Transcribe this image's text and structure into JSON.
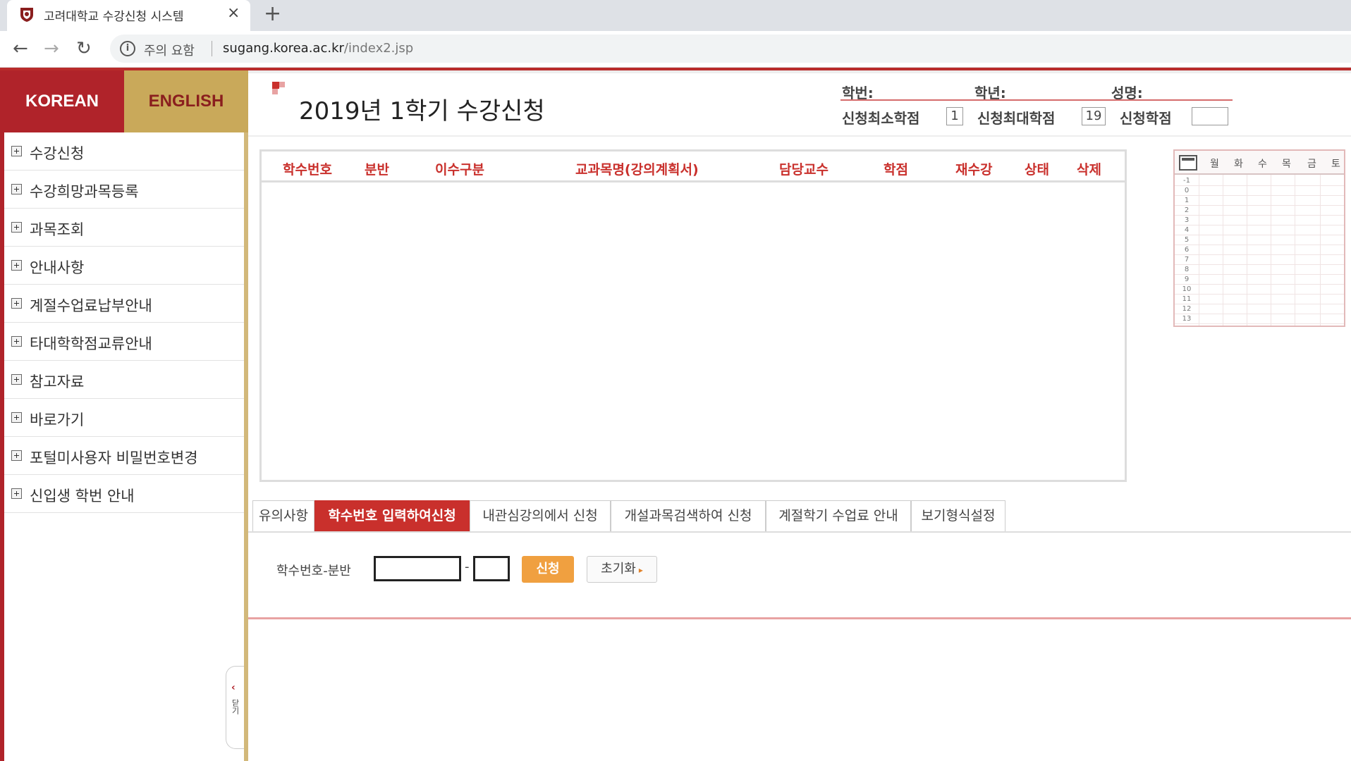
{
  "browser": {
    "tab_title": "고려대학교 수강신청 시스템",
    "tab_close": "×",
    "new_tab": "+",
    "back": "←",
    "forward": "→",
    "reload": "↻",
    "security_label": "주의 요함",
    "url_host": "sugang.korea.ac.kr",
    "url_path": "/index2.jsp"
  },
  "sidebar": {
    "lang_korean": "KOREAN",
    "lang_english": "ENGLISH",
    "items": [
      {
        "label": "수강신청"
      },
      {
        "label": "수강희망과목등록"
      },
      {
        "label": "과목조회"
      },
      {
        "label": "안내사항"
      },
      {
        "label": "계절수업료납부안내"
      },
      {
        "label": "타대학학점교류안내"
      },
      {
        "label": "참고자료"
      },
      {
        "label": "바로가기"
      },
      {
        "label": "포털미사용자 비밀번호변경"
      },
      {
        "label": "신입생 학번 안내"
      }
    ],
    "collapse_label": "닫기"
  },
  "header": {
    "title": "2019년 1학기 수강신청",
    "student_id_label": "학번:",
    "grade_label": "학년:",
    "name_label": "성명:",
    "min_credits_label": "신청최소학점",
    "min_credits_value": "1",
    "max_credits_label": "신청최대학점",
    "max_credits_value": "19",
    "applied_credits_label": "신청학점",
    "applied_credits_value": ""
  },
  "course_table": {
    "columns": [
      "학수번호",
      "분반",
      "이수구분",
      "교과목명(강의계획서)",
      "담당교수",
      "학점",
      "재수강",
      "상태",
      "삭제"
    ],
    "rows": []
  },
  "timetable": {
    "days": [
      "월",
      "화",
      "수",
      "목",
      "금",
      "토"
    ],
    "periods": [
      "-1",
      "0",
      "1",
      "2",
      "3",
      "4",
      "5",
      "6",
      "7",
      "8",
      "9",
      "10",
      "11",
      "12",
      "13"
    ]
  },
  "tabs": [
    {
      "label": "유의사항",
      "active": false
    },
    {
      "label": "학수번호 입력하여신청",
      "active": true
    },
    {
      "label": "내관심강의에서 신청",
      "active": false
    },
    {
      "label": "개설과목검색하여 신청",
      "active": false
    },
    {
      "label": "계절학기 수업료 안내",
      "active": false
    },
    {
      "label": "보기형식설정",
      "active": false
    }
  ],
  "form": {
    "label": "학수번호-분반",
    "course_code_value": "",
    "section_value": "",
    "dash": "-",
    "apply_label": "신청",
    "reset_label": "초기화",
    "reset_arrow": "▸"
  },
  "colors": {
    "brand_red": "#b0232a",
    "brand_gold": "#c9a95a",
    "accent_orange": "#f0a040",
    "header_text_red": "#c9302c"
  }
}
